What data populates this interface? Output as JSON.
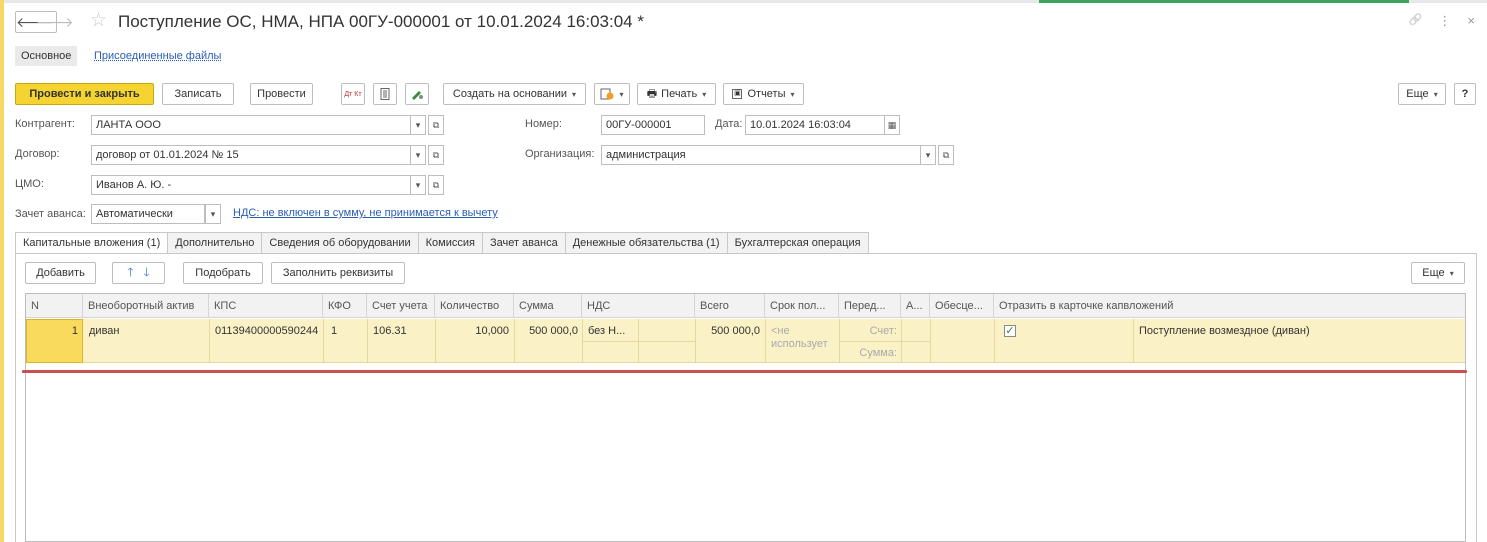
{
  "window": {
    "title": "Поступление ОС, НМА, НПА 00ГУ-000001 от 10.01.2024 16:03:04 *",
    "back_glyph": "🡐",
    "forward_glyph": "🡒",
    "star_glyph": "☆",
    "link_glyph": "🔗",
    "more_glyph": "⋮",
    "close_glyph": "×"
  },
  "top_tabs": {
    "main": "Основное",
    "files": "Присоединенные файлы"
  },
  "toolbar": {
    "post_close": "Провести и закрыть",
    "save": "Записать",
    "post": "Провести",
    "dtkt": "Дт Кт",
    "create_based": "Создать на основании",
    "print": "Печать",
    "reports": "Отчеты",
    "more": "Еще",
    "help": "?"
  },
  "form": {
    "counterparty_label": "Контрагент:",
    "counterparty_value": "ЛАНТА ООО",
    "contract_label": "Договор:",
    "contract_value": "договор от 01.01.2024 № 15",
    "cmo_label": "ЦМО:",
    "cmo_value": "Иванов А. Ю. -",
    "advance_label": "Зачет аванса:",
    "advance_value": "Автоматически",
    "vat_link": "НДС: не включен в сумму, не принимается к вычету",
    "number_label": "Номер:",
    "number_value": "00ГУ-000001",
    "date_label": "Дата:",
    "date_value": "10.01.2024 16:03:04",
    "org_label": "Организация:",
    "org_value": "администрация"
  },
  "tabs": [
    "Капитальные вложения (1)",
    "Дополнительно",
    "Сведения об оборудовании",
    "Комиссия",
    "Зачет аванса",
    "Денежные обязательства (1)",
    "Бухгалтерская операция"
  ],
  "table_toolbar": {
    "add": "Добавить",
    "pick": "Подобрать",
    "fill": "Заполнить реквизиты",
    "more": "Еще"
  },
  "table": {
    "headers": [
      "N",
      "Внеоборотный актив",
      "КПС",
      "КФО",
      "Счет учета",
      "Количество",
      "Сумма",
      "НДС",
      "Всего",
      "Срок пол...",
      "Перед...",
      "А...",
      "Обесце...",
      "Отразить в карточке капвложений"
    ],
    "row": {
      "n": "1",
      "asset": "диван",
      "kps": "01139400000590244",
      "kfo": "1",
      "account": "106.31",
      "qty": "10,000",
      "sum": "500 000,0",
      "vat": "без Н...",
      "total": "500 000,0",
      "term": "<не использует",
      "account_sub": "Счет:",
      "sum_sub": "Сумма:",
      "reflect_checked": true,
      "operation": "Поступление возмездное (диван)"
    }
  }
}
